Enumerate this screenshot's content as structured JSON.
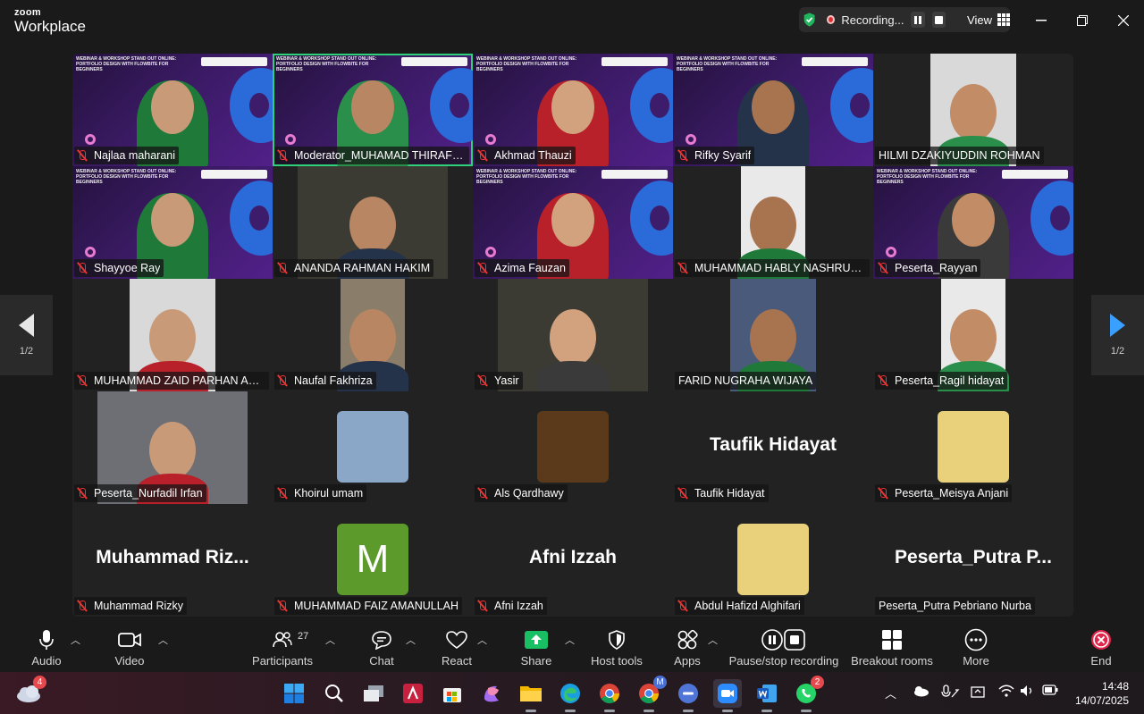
{
  "app": {
    "brand_small": "zoom",
    "brand_big": "Workplace"
  },
  "titlebar": {
    "recording_label": "Recording...",
    "view_label": "View"
  },
  "gallery": {
    "page_indicator_left": "1/2",
    "page_indicator_right": "1/2",
    "tiles": [
      {
        "name": "Najlaa maharani",
        "type": "webinar"
      },
      {
        "name": "Moderator_MUHAMAD THIRAFI QAE...",
        "type": "webinar",
        "highlight": true
      },
      {
        "name": "Akhmad Thauzi",
        "type": "webinar"
      },
      {
        "name": "Rifky Syarif",
        "type": "webinar"
      },
      {
        "name": "HILMI DZAKIYUDDIN ROHMAN",
        "type": "camera",
        "muted": false
      },
      {
        "name": "Shayyoe Ray",
        "type": "webinar"
      },
      {
        "name": "ANANDA RAHMAN HAKIM",
        "type": "camera"
      },
      {
        "name": "Azima Fauzan",
        "type": "webinar"
      },
      {
        "name": "MUHAMMAD HABLY NASHRULLAH",
        "type": "camera"
      },
      {
        "name": "Peserta_Rayyan",
        "type": "webinar"
      },
      {
        "name": "MUHAMMAD ZAID PARHAN ADRI...",
        "type": "camera"
      },
      {
        "name": "Naufal Fakhriza",
        "type": "camera"
      },
      {
        "name": "Yasir",
        "type": "camera"
      },
      {
        "name": "FARID NUGRAHA WIJAYA",
        "type": "camera",
        "muted": false
      },
      {
        "name": "Peserta_Ragil hidayat",
        "type": "camera"
      },
      {
        "name": "Peserta_Nurfadil Irfan",
        "type": "camera"
      },
      {
        "name": "Khoirul umam",
        "type": "avatar"
      },
      {
        "name": "Als Qardhawy",
        "type": "avatar"
      },
      {
        "name": "Taufik Hidayat",
        "type": "text",
        "display": "Taufik Hidayat"
      },
      {
        "name": "Peserta_Meisya Anjani",
        "type": "avatar"
      },
      {
        "name": "Muhammad Rizky",
        "type": "text",
        "display": "Muhammad  Riz..."
      },
      {
        "name": "MUHAMMAD FAIZ AMANULLAH",
        "type": "letter",
        "display": "M"
      },
      {
        "name": "Afni Izzah",
        "type": "text",
        "display": "Afni Izzah"
      },
      {
        "name": "Abdul Hafizd Alghifari",
        "type": "avatar"
      },
      {
        "name": "Peserta_Putra Pebriano Nurba",
        "type": "text",
        "display": "Peserta_Putra  P...",
        "muted": false
      }
    ],
    "webinar_header": "WEBINAR & WORKSHOP STAND OUT ONLINE: PORTFOLIO DESIGN WITH FLOWBITE FOR BEGINNERS"
  },
  "toolbar": {
    "audio": "Audio",
    "video": "Video",
    "participants": "Participants",
    "participants_count": "27",
    "chat": "Chat",
    "react": "React",
    "share": "Share",
    "host_tools": "Host tools",
    "apps": "Apps",
    "pause_stop": "Pause/stop recording",
    "breakout": "Breakout rooms",
    "more": "More",
    "end": "End"
  },
  "taskbar": {
    "weather_badge": "4",
    "whatsapp_badge": "2",
    "chrome_profile_badge": "M",
    "time": "14:48",
    "date": "14/07/2025"
  },
  "colors": {
    "highlight": "#2ed17a",
    "share_green": "#19c063",
    "end_red": "#e0244a",
    "muted_red": "#e33333"
  }
}
